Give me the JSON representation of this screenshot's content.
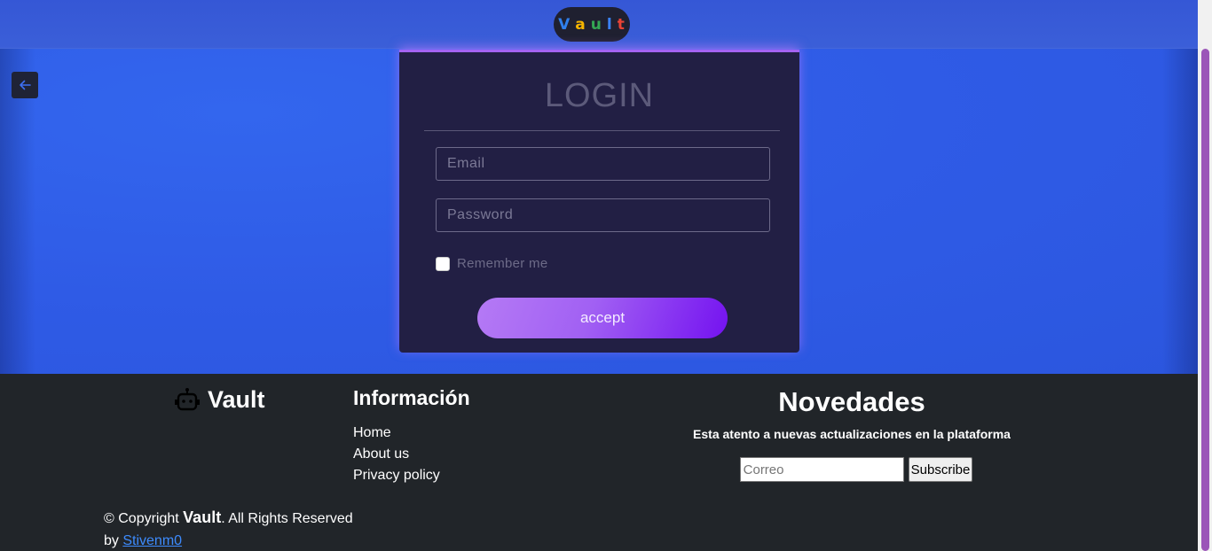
{
  "brand": {
    "letters": [
      {
        "char": "V",
        "color": "#2f80ed"
      },
      {
        "char": "a",
        "color": "#f4b400"
      },
      {
        "char": "u",
        "color": "#34a853"
      },
      {
        "char": "l",
        "color": "#3b82f6"
      },
      {
        "char": "t",
        "color": "#ea4335"
      }
    ]
  },
  "back_icon": "arrow-left-icon",
  "login": {
    "title": "LOGIN",
    "email_placeholder": "Email",
    "password_placeholder": "Password",
    "remember_label": "Remember me",
    "accept_label": "accept"
  },
  "footer": {
    "logo_icon": "robot-icon",
    "logo_text": "Vault",
    "info_title": "Información",
    "links": [
      "Home",
      "About us",
      "Privacy policy"
    ],
    "news_title": "Novedades",
    "news_subtitle": "Esta atento a nuevas actualizaciones en la plataforma",
    "newsletter_placeholder": "Correo",
    "subscribe_label": "Subscribe",
    "copyright_prefix": "© Copyright",
    "copyright_brand": "Vault",
    "copyright_suffix": ". All Rights Reserved",
    "by_prefix": "by",
    "author": "Stivenm0"
  },
  "colors": {
    "hero_blue": "#2f5be6",
    "card_bg": "#221f44",
    "accent_purple": "#a463f2",
    "footer_bg": "#212529"
  }
}
